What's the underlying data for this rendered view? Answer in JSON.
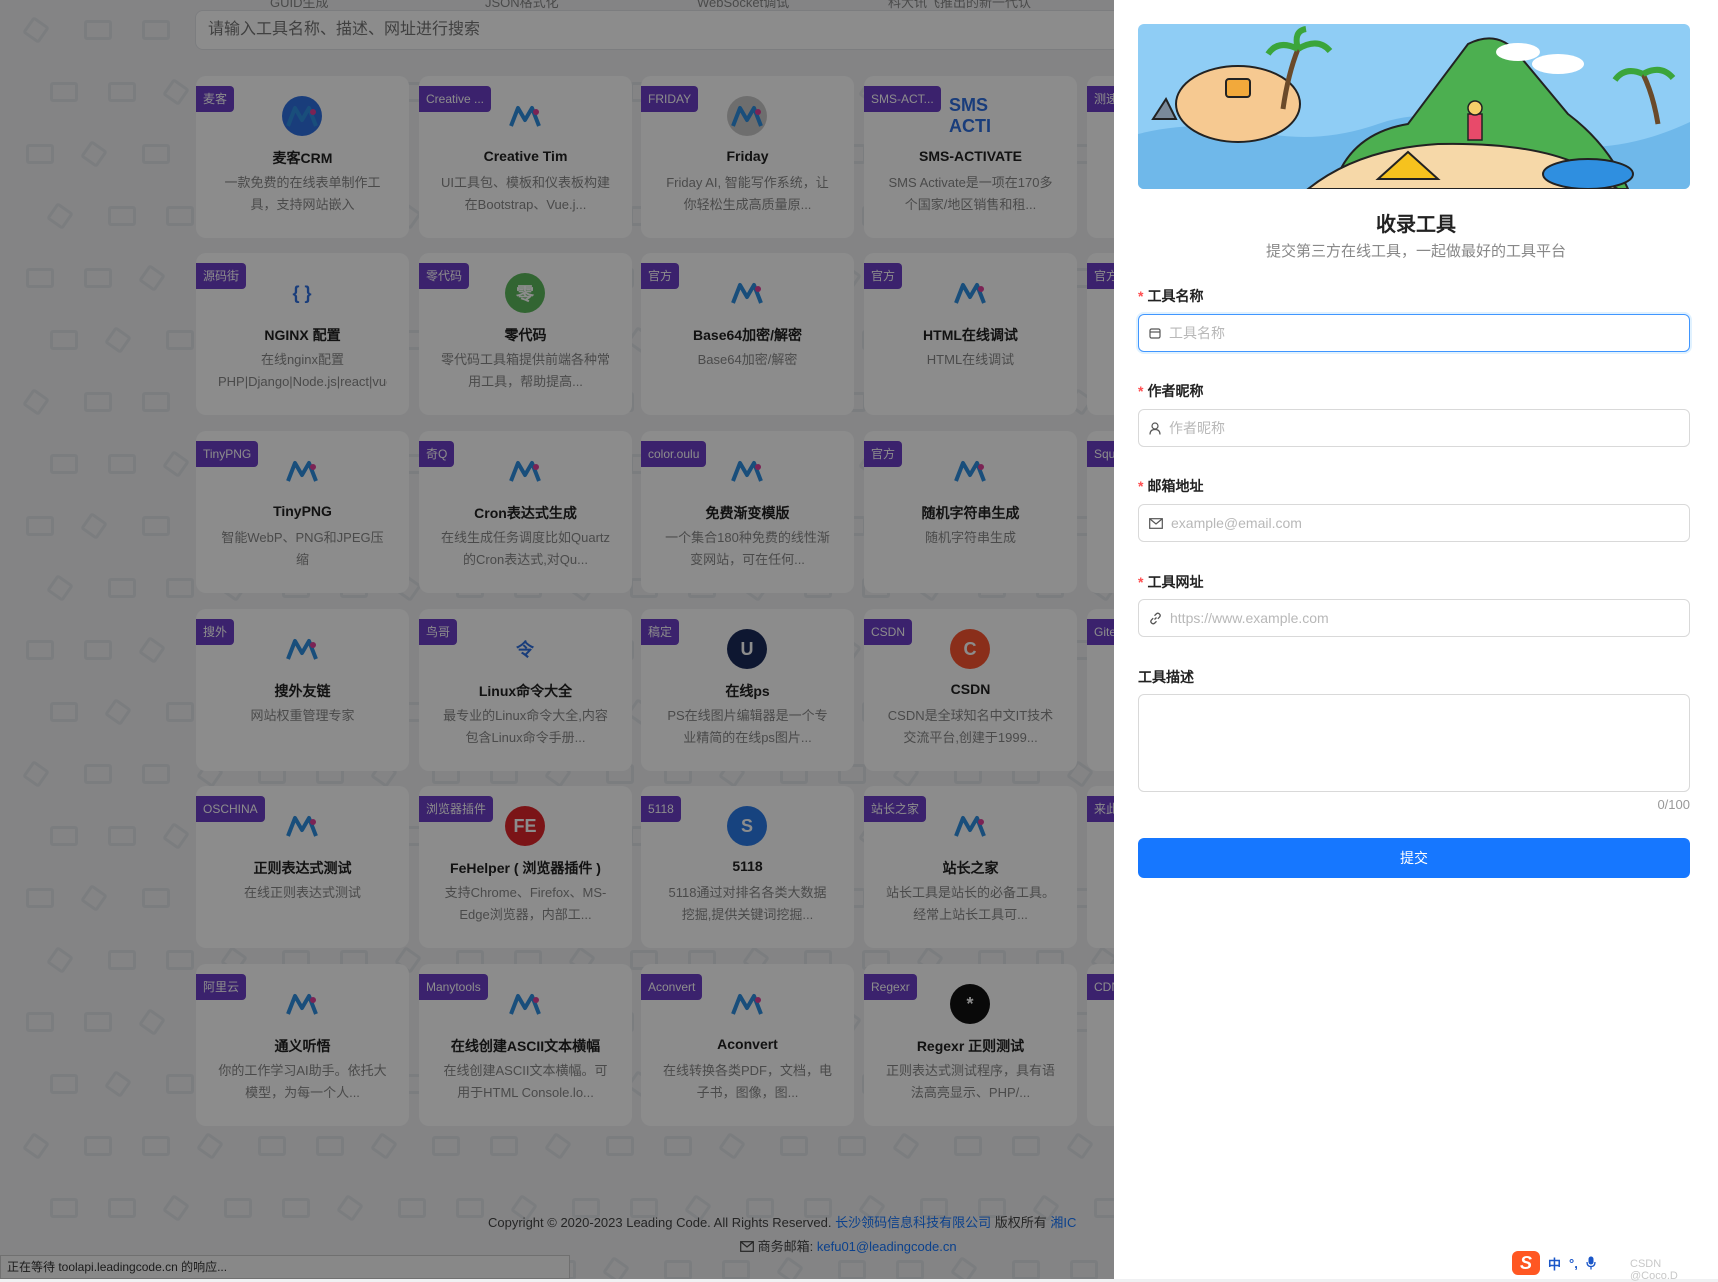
{
  "search": {
    "placeholder": "请输入工具名称、描述、网址进行搜索"
  },
  "top_labels": [
    "GUID生成",
    "JSON格式化",
    "WebSocket调试",
    "科大讯飞推出的新一代认"
  ],
  "cards": [
    {
      "tag": "麦客",
      "name": "麦客CRM",
      "desc": "一款免费的在线表单制作工具，支持网站嵌入",
      "color": "#2f6fe0",
      "icon": "makecrm-logo-icon"
    },
    {
      "tag": "Creative ...",
      "name": "Creative Tim",
      "desc": "UI工具包、模板和仪表板构建在Bootstrap、Vue.j...",
      "color": "#ffffff",
      "icon": "creative-tim-logo-icon"
    },
    {
      "tag": "FRIDAY",
      "name": "Friday",
      "desc": "Friday AI, 智能写作系统，让你轻松生成高质量原...",
      "color": "#c9c9c9",
      "icon": "friday-logo-icon"
    },
    {
      "tag": "SMS-ACT...",
      "name": "SMS-ACTIVATE",
      "desc": "SMS Activate是一项在170多个国家/地区销售和租...",
      "color": "#ffffff",
      "icon": "sms-activate-logo-icon",
      "logo_text": "SMS ACTI"
    },
    {
      "tag": "源码街",
      "name": "NGINX 配置",
      "desc": "在线nginx配置PHP|Django|Node.js|react|vue|Wor...",
      "color": "#ffffff",
      "icon": "braces-icon",
      "logo_text": "{ }"
    },
    {
      "tag": "零代码",
      "name": "零代码",
      "desc": "零代码工具箱提供前端各种常用工具，帮助提高...",
      "color": "#5cb85c",
      "icon": "lingdaima-logo-icon",
      "logo_text": "零"
    },
    {
      "tag": "官方",
      "name": "Base64加密/解密",
      "desc": "Base64加密/解密",
      "color": "#ffffff",
      "icon": "leadingcode-logo-icon"
    },
    {
      "tag": "官方",
      "name": "HTML在线调试",
      "desc": "HTML在线调试",
      "color": "#ffffff",
      "icon": "leadingcode-logo-icon"
    },
    {
      "tag": "TinyPNG",
      "name": "TinyPNG",
      "desc": "智能WebP、PNG和JPEG压缩",
      "color": "#ffffff",
      "icon": "panda-icon"
    },
    {
      "tag": "奇Q",
      "name": "Cron表达式生成",
      "desc": "在线生成任务调度比如Quartz的Cron表达式,对Qu...",
      "color": "#ffffff",
      "icon": "tshirt-icon"
    },
    {
      "tag": "color.oulu",
      "name": "免费渐变模版",
      "desc": "一个集合180种免费的线性渐变网站，可在任何...",
      "color": "#ffffff",
      "icon": "ring-icon"
    },
    {
      "tag": "官方",
      "name": "随机字符串生成",
      "desc": "随机字符串生成",
      "color": "#ffffff",
      "icon": "leadingcode-logo-icon"
    },
    {
      "tag": "搜外",
      "name": "搜外友链",
      "desc": "网站权重管理专家",
      "color": "#ffffff",
      "icon": "souwai-logo-icon"
    },
    {
      "tag": "鸟哥",
      "name": "Linux命令大全",
      "desc": "最专业的Linux命令大全,内容包含Linux命令手册...",
      "color": "#ffffff",
      "icon": "linux-command-logo-icon",
      "logo_text": "令"
    },
    {
      "tag": "稿定",
      "name": "在线ps",
      "desc": "PS在线图片编辑器是一个专业精简的在线ps图片...",
      "color": "#1a2a5a",
      "icon": "online-ps-logo-icon",
      "logo_text": "U"
    },
    {
      "tag": "CSDN",
      "name": "CSDN",
      "desc": "CSDN是全球知名中文IT技术交流平台,创建于1999...",
      "color": "#fc5531",
      "icon": "csdn-logo-icon",
      "logo_text": "C"
    },
    {
      "tag": "OSCHINA",
      "name": "正则表达式测试",
      "desc": "在线正则表达式测试",
      "color": "#ffffff",
      "icon": "oschina-logo-icon"
    },
    {
      "tag": "浏览器插件",
      "name": "FeHelper ( 浏览器插件 )",
      "desc": "支持Chrome、Firefox、MS-Edge浏览器，内部工...",
      "color": "#e0262b",
      "icon": "fehelper-logo-icon",
      "logo_text": "FE"
    },
    {
      "tag": "5118",
      "name": "5118",
      "desc": "5118通过对排名各类大数据挖掘,提供关键词挖掘...",
      "color": "#2a7ae8",
      "icon": "5118-logo-icon",
      "logo_text": "S"
    },
    {
      "tag": "站长之家",
      "name": "站长之家",
      "desc": "站长工具是站长的必备工具。经常上站长工具可...",
      "color": "#ffffff",
      "icon": "chinaz-logo-icon"
    },
    {
      "tag": "阿里云",
      "name": "通义听悟",
      "desc": "你的工作学习AI助手。依托大模型，为每一个人...",
      "color": "#ffffff",
      "icon": "tingwu-logo-icon"
    },
    {
      "tag": "Manytools",
      "name": "在线创建ASCII文本横幅",
      "desc": "在线创建ASCII文本横幅。可用于HTML Console.lo...",
      "color": "#ffffff",
      "icon": "manytools-logo-icon"
    },
    {
      "tag": "Aconvert",
      "name": "Aconvert",
      "desc": "在线转换各类PDF，文档，电子书，图像，图...",
      "color": "#ffffff",
      "icon": "aconvert-logo-icon"
    },
    {
      "tag": "Regexr",
      "name": "Regexr 正则测试",
      "desc": "正则表达式测试程序，具有语法高亮显示、PHP/...",
      "color": "#111111",
      "icon": "regexr-logo-icon",
      "logo_text": "*"
    }
  ],
  "side_tags": [
    "测速",
    "官方",
    "Squ",
    "Gite",
    "来此",
    "CDN"
  ],
  "footer": {
    "copyright": "Copyright © 2020-2023 Leading Code. All Rights Reserved.",
    "company": "长沙领码信息科技有限公司",
    "rights": "版权所有",
    "icp": "湘IC",
    "email_label": "商务邮箱:",
    "email": "kefu01@leadingcode.cn"
  },
  "status_bar": "正在等待 toolapi.leadingcode.cn 的响应...",
  "drawer": {
    "title": "收录工具",
    "subtitle": "提交第三方在线工具，一起做最好的工具平台",
    "fields": {
      "tool_name": {
        "label": "工具名称",
        "placeholder": "工具名称"
      },
      "author": {
        "label": "作者昵称",
        "placeholder": "作者昵称"
      },
      "email": {
        "label": "邮箱地址",
        "placeholder": "example@email.com"
      },
      "url": {
        "label": "工具网址",
        "placeholder": "https://www.example.com"
      },
      "description": {
        "label": "工具描述",
        "counter": "0/100"
      }
    },
    "submit_label": "提交"
  },
  "ime": {
    "lang": "中",
    "punct": "°,",
    "watermark": "CSDN @Coco.D"
  },
  "colors": {
    "tag": "#6c3ec6",
    "primary": "#1677ff",
    "required": "#ff4d4f"
  }
}
